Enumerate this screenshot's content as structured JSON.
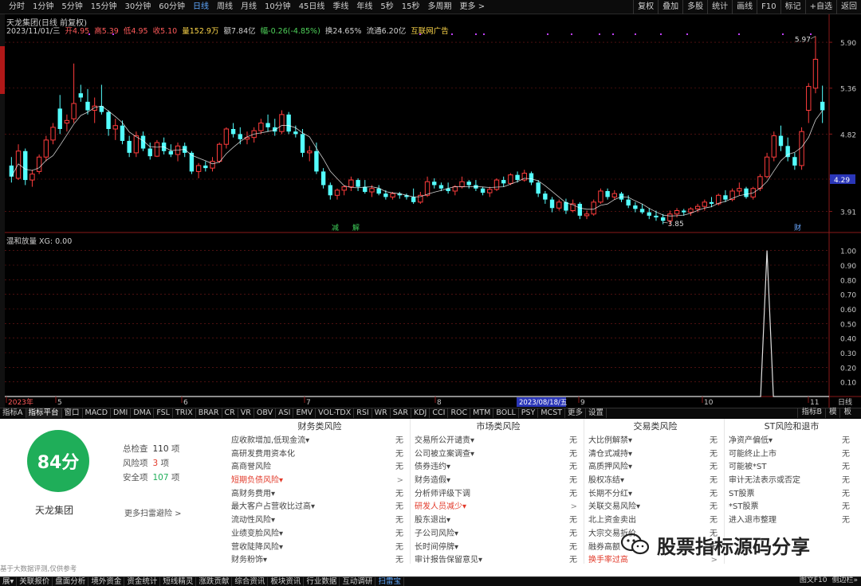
{
  "topbar": {
    "periods": [
      "分时",
      "1分钟",
      "5分钟",
      "15分钟",
      "30分钟",
      "60分钟",
      "日线",
      "周线",
      "月线",
      "10分钟",
      "45日线",
      "季线",
      "年线",
      "5秒",
      "15秒",
      "多周期",
      "更多 >"
    ],
    "active_period": "日线",
    "right_buttons": [
      "复权",
      "叠加",
      "多股",
      "统计",
      "画线",
      "F10",
      "标记",
      "+自选",
      "返回"
    ]
  },
  "info": {
    "title": "天龙集团(日线 前复权)",
    "date": "2023/11/01/三",
    "open": "开4.95",
    "high": "高5.39",
    "low": "低4.95",
    "close": "收5.10",
    "volume": "量152.9万",
    "amount": "额7.84亿",
    "change": "幅-0.26(-4.85%)",
    "turnover": "换24.65%",
    "float_cap": "流通6.20亿",
    "tag": "互联网广告"
  },
  "colors": {
    "up": "#ff3c3c",
    "down": "#54ffff",
    "ma": "#ffffff",
    "grid": "#7a1a1a",
    "axis_text": "#c8c8c8",
    "indicator_line": "#e0e0e0",
    "score_green": "#1fae59",
    "warn_red": "#e23a2a",
    "price_tag_bg": "#2a36b8"
  },
  "chart_data": {
    "type": "candlestick",
    "price_axis": [
      "5.90",
      "5.36",
      "4.82",
      "4.29",
      "3.91"
    ],
    "ylim": [
      3.7,
      6.06
    ],
    "current_price_label": "4.29",
    "high_label": "5.97",
    "low_label": "3.85",
    "x_labels": [
      "2023年",
      "5",
      "6",
      "7",
      "8",
      "9",
      "10",
      "11"
    ],
    "date_tag": "2023/08/18/五",
    "markers": [
      "减",
      "解",
      "财"
    ],
    "candles": [
      [
        4.45,
        4.55,
        4.25,
        4.32
      ],
      [
        4.3,
        4.7,
        4.28,
        4.62
      ],
      [
        4.62,
        4.65,
        4.22,
        4.28
      ],
      [
        4.28,
        4.4,
        4.2,
        4.35
      ],
      [
        4.38,
        4.58,
        4.35,
        4.55
      ],
      [
        4.55,
        4.8,
        4.5,
        4.75
      ],
      [
        4.75,
        4.95,
        4.7,
        4.9
      ],
      [
        5.12,
        5.28,
        4.82,
        4.88
      ],
      [
        4.95,
        5.05,
        4.85,
        4.98
      ],
      [
        5.0,
        5.65,
        4.95,
        5.18
      ],
      [
        5.3,
        5.4,
        5.2,
        5.25
      ],
      [
        5.2,
        5.35,
        5.05,
        5.1
      ],
      [
        5.1,
        5.25,
        4.95,
        5.15
      ],
      [
        5.15,
        5.4,
        5.05,
        5.08
      ],
      [
        5.08,
        5.1,
        4.8,
        4.88
      ],
      [
        4.88,
        5.0,
        4.75,
        4.92
      ],
      [
        4.92,
        4.98,
        4.7,
        4.74
      ],
      [
        4.74,
        4.8,
        4.55,
        4.6
      ],
      [
        4.6,
        4.85,
        4.55,
        4.8
      ],
      [
        4.8,
        4.85,
        4.62,
        4.65
      ],
      [
        4.65,
        4.72,
        4.52,
        4.56
      ],
      [
        4.56,
        4.75,
        4.55,
        4.72
      ],
      [
        4.72,
        4.78,
        4.58,
        4.62
      ],
      [
        4.62,
        4.7,
        4.55,
        4.58
      ],
      [
        4.58,
        4.72,
        4.5,
        4.68
      ],
      [
        4.68,
        4.72,
        4.55,
        4.6
      ],
      [
        4.6,
        4.62,
        4.35,
        4.38
      ],
      [
        4.38,
        4.48,
        4.3,
        4.45
      ],
      [
        4.45,
        4.5,
        4.38,
        4.42
      ],
      [
        4.42,
        4.55,
        4.38,
        4.5
      ],
      [
        4.5,
        4.72,
        4.48,
        4.7
      ],
      [
        4.7,
        4.9,
        4.65,
        4.88
      ],
      [
        4.88,
        4.95,
        4.78,
        4.82
      ],
      [
        4.82,
        4.9,
        4.7,
        4.76
      ],
      [
        4.76,
        4.85,
        4.7,
        4.78
      ],
      [
        4.78,
        4.9,
        4.72,
        4.86
      ],
      [
        4.86,
        5.0,
        4.82,
        4.95
      ],
      [
        4.95,
        5.05,
        4.85,
        4.9
      ],
      [
        4.9,
        5.0,
        4.8,
        4.85
      ],
      [
        4.85,
        5.1,
        4.82,
        5.05
      ],
      [
        5.05,
        5.08,
        4.82,
        4.85
      ],
      [
        4.85,
        4.92,
        4.78,
        4.82
      ],
      [
        4.82,
        4.88,
        4.55,
        4.6
      ],
      [
        4.6,
        4.68,
        4.5,
        4.62
      ],
      [
        4.62,
        4.72,
        4.35,
        4.38
      ],
      [
        4.38,
        4.42,
        4.18,
        4.22
      ],
      [
        4.22,
        4.25,
        4.05,
        4.1
      ],
      [
        4.1,
        4.18,
        4.05,
        4.16
      ],
      [
        4.16,
        4.22,
        4.1,
        4.2
      ],
      [
        4.2,
        4.32,
        4.15,
        4.28
      ],
      [
        4.28,
        4.3,
        4.15,
        4.2
      ],
      [
        4.2,
        4.28,
        4.12,
        4.14
      ],
      [
        4.14,
        4.22,
        4.08,
        4.18
      ],
      [
        4.18,
        4.22,
        4.1,
        4.12
      ],
      [
        4.12,
        4.16,
        4.05,
        4.08
      ],
      [
        4.08,
        4.14,
        4.05,
        4.12
      ],
      [
        4.12,
        4.14,
        4.06,
        4.1
      ],
      [
        4.1,
        4.12,
        4.05,
        4.08
      ],
      [
        4.08,
        4.18,
        4.0,
        4.02
      ],
      [
        4.02,
        4.14,
        4.0,
        4.1
      ],
      [
        4.1,
        4.32,
        4.08,
        4.26
      ],
      [
        4.26,
        4.3,
        4.18,
        4.22
      ],
      [
        4.22,
        4.25,
        4.15,
        4.18
      ],
      [
        4.18,
        4.25,
        4.12,
        4.15
      ],
      [
        4.15,
        4.22,
        4.1,
        4.2
      ],
      [
        4.2,
        4.32,
        4.18,
        4.26
      ],
      [
        4.26,
        4.28,
        4.18,
        4.22
      ],
      [
        4.22,
        4.28,
        4.15,
        4.18
      ],
      [
        4.18,
        4.2,
        4.1,
        4.13
      ],
      [
        4.13,
        4.2,
        4.08,
        4.17
      ],
      [
        4.17,
        4.3,
        4.15,
        4.28
      ],
      [
        4.28,
        4.32,
        4.2,
        4.24
      ],
      [
        4.24,
        4.36,
        4.22,
        4.34
      ],
      [
        4.34,
        4.38,
        4.25,
        4.28
      ],
      [
        4.28,
        4.4,
        4.26,
        4.36
      ],
      [
        4.36,
        4.38,
        4.22,
        4.25
      ],
      [
        4.25,
        4.28,
        4.08,
        4.12
      ],
      [
        4.12,
        4.15,
        4.0,
        4.05
      ],
      [
        4.05,
        4.08,
        3.9,
        3.95
      ],
      [
        3.95,
        4.05,
        3.92,
        4.02
      ],
      [
        4.02,
        4.06,
        3.88,
        3.92
      ],
      [
        3.92,
        4.05,
        3.9,
        4.0
      ],
      [
        4.0,
        4.02,
        3.82,
        3.86
      ],
      [
        3.86,
        3.92,
        3.82,
        3.88
      ],
      [
        3.88,
        4.05,
        3.86,
        4.02
      ],
      [
        4.02,
        4.18,
        4.0,
        4.15
      ],
      [
        4.15,
        4.18,
        4.05,
        4.08
      ],
      [
        4.08,
        4.16,
        4.05,
        4.12
      ],
      [
        4.12,
        4.14,
        4.02,
        4.05
      ],
      [
        4.05,
        4.1,
        3.95,
        3.98
      ],
      [
        3.98,
        4.02,
        3.9,
        3.94
      ],
      [
        3.94,
        4.0,
        3.88,
        3.9
      ],
      [
        3.9,
        3.95,
        3.82,
        3.86
      ],
      [
        3.86,
        3.92,
        3.8,
        3.84
      ],
      [
        3.84,
        3.88,
        3.76,
        3.8
      ],
      [
        3.8,
        3.92,
        3.75,
        3.88
      ],
      [
        3.88,
        3.95,
        3.84,
        3.92
      ],
      [
        3.92,
        3.94,
        3.86,
        3.9
      ],
      [
        3.9,
        3.96,
        3.86,
        3.94
      ],
      [
        3.94,
        4.0,
        3.9,
        3.97
      ],
      [
        3.97,
        4.05,
        3.92,
        4.02
      ],
      [
        4.02,
        4.08,
        3.96,
        4.0
      ],
      [
        4.0,
        4.12,
        3.98,
        4.1
      ],
      [
        4.1,
        4.16,
        4.02,
        4.05
      ],
      [
        4.05,
        4.18,
        4.03,
        4.15
      ],
      [
        4.15,
        4.25,
        4.1,
        4.18
      ],
      [
        4.18,
        4.2,
        4.06,
        4.08
      ],
      [
        4.08,
        4.2,
        4.05,
        4.18
      ],
      [
        4.18,
        4.35,
        4.15,
        4.32
      ],
      [
        4.32,
        4.6,
        4.3,
        4.55
      ],
      [
        4.55,
        4.85,
        4.5,
        4.8
      ],
      [
        4.8,
        4.92,
        4.62,
        4.68
      ],
      [
        4.68,
        4.78,
        4.5,
        4.55
      ],
      [
        4.55,
        4.6,
        4.4,
        4.45
      ],
      [
        4.45,
        4.9,
        4.4,
        4.85
      ],
      [
        5.1,
        5.42,
        4.95,
        5.38
      ],
      [
        5.36,
        5.97,
        5.3,
        5.7
      ],
      [
        5.2,
        5.39,
        4.95,
        5.1
      ]
    ],
    "indicator": {
      "title": "温和放量 XG: 0.00",
      "axis": [
        "1.00",
        "0.90",
        "0.80",
        "0.70",
        "0.60",
        "0.50",
        "0.40",
        "0.30",
        "0.20",
        "0.10"
      ],
      "ylim": [
        0,
        1.08
      ],
      "spike_index": 109,
      "spike_value": 1.0
    }
  },
  "indicator_tabs": [
    "指标A",
    "指标平台",
    "窗口",
    "MACD",
    "DMI",
    "DMA",
    "FSL",
    "TRIX",
    "BRAR",
    "CR",
    "VR",
    "OBV",
    "ASI",
    "EMV",
    "VOL-TDX",
    "RSI",
    "WR",
    "SAR",
    "KDJ",
    "CCI",
    "ROC",
    "MTM",
    "BOLL",
    "PSY",
    "MCST",
    "更多",
    "设置"
  ],
  "active_tab": "指标平台",
  "right_tabs": [
    "指标B",
    "模",
    "板"
  ],
  "panel": {
    "score": "84分",
    "company": "天龙集团",
    "stats": [
      {
        "label": "总检查",
        "value": "110",
        "unit": "项",
        "color": "#333333"
      },
      {
        "label": "风险项",
        "value": "3",
        "unit": "项",
        "color": "#e23a2a"
      },
      {
        "label": "安全项",
        "value": "107",
        "unit": "项",
        "color": "#1fae59"
      }
    ],
    "more_scan": "更多扫雷避险 >",
    "disclaimer": "基于大数据评测,仅供参考",
    "columns": [
      {
        "title": "财务类风险",
        "items": [
          {
            "label": "应收款增加,低现金流▾",
            "status": "无",
            "warn": false
          },
          {
            "label": "高研发费用资本化",
            "status": "无",
            "warn": false
          },
          {
            "label": "高商誉风险",
            "status": "无",
            "warn": false
          },
          {
            "label": "短期负债风险▾",
            "status": ">",
            "warn": true
          },
          {
            "label": "高财务费用▾",
            "status": "无",
            "warn": false
          },
          {
            "label": "最大客户占营收比过高▾",
            "status": "无",
            "warn": false
          },
          {
            "label": "流动性风险▾",
            "status": "无",
            "warn": false
          },
          {
            "label": "业绩变脸风险▾",
            "status": "无",
            "warn": false
          },
          {
            "label": "营收陡降风险▾",
            "status": "无",
            "warn": false
          },
          {
            "label": "财务粉饰▾",
            "status": "无",
            "warn": false
          }
        ]
      },
      {
        "title": "市场类风险",
        "items": [
          {
            "label": "交易所公开谴责▾",
            "status": "无",
            "warn": false
          },
          {
            "label": "公司被立案调查▾",
            "status": "无",
            "warn": false
          },
          {
            "label": "债券违约▾",
            "status": "无",
            "warn": false
          },
          {
            "label": "财务造假▾",
            "status": "无",
            "warn": false
          },
          {
            "label": "分析师评级下调",
            "status": "无",
            "warn": false
          },
          {
            "label": "研发人员减少▾",
            "status": ">",
            "warn": true
          },
          {
            "label": "股东退出▾",
            "status": "无",
            "warn": false
          },
          {
            "label": "子公司风险▾",
            "status": "无",
            "warn": false
          },
          {
            "label": "长时间停牌▾",
            "status": "无",
            "warn": false
          },
          {
            "label": "审计报告保留意见▾",
            "status": "无",
            "warn": false
          }
        ]
      },
      {
        "title": "交易类风险",
        "items": [
          {
            "label": "大比例解禁▾",
            "status": "无",
            "warn": false
          },
          {
            "label": "清仓式减持▾",
            "status": "无",
            "warn": false
          },
          {
            "label": "高质押风险▾",
            "status": "无",
            "warn": false
          },
          {
            "label": "股权冻结▾",
            "status": "无",
            "warn": false
          },
          {
            "label": "长期不分红▾",
            "status": "无",
            "warn": false
          },
          {
            "label": "关联交易风险▾",
            "status": "无",
            "warn": false
          },
          {
            "label": "北上资金卖出",
            "status": "无",
            "warn": false
          },
          {
            "label": "大宗交易折价",
            "status": "无",
            "warn": false
          },
          {
            "label": "融券高额",
            "status": "无",
            "warn": false
          },
          {
            "label": "换手率过高",
            "status": ">",
            "warn": true
          }
        ]
      },
      {
        "title": "ST风险和退市",
        "items": [
          {
            "label": "净资产偏低▾",
            "status": "无",
            "warn": false
          },
          {
            "label": "可能终止上市",
            "status": "无",
            "warn": false
          },
          {
            "label": "可能被*ST",
            "status": "无",
            "warn": false
          },
          {
            "label": "审计无法表示或否定",
            "status": "无",
            "warn": false
          },
          {
            "label": "ST股票",
            "status": "无",
            "warn": false
          },
          {
            "label": "*ST股票",
            "status": "无",
            "warn": false
          },
          {
            "label": "进入退市整理",
            "status": "无",
            "warn": false
          }
        ]
      }
    ]
  },
  "watermark": {
    "text": "股票指标源码分享",
    "icon": "wechat-icon"
  },
  "bottombar": {
    "tabs": [
      "展▾",
      "关联报价",
      "盘面分析",
      "境外资金",
      "资金统计",
      "短线精灵",
      "涨跌贡献",
      "综合资讯",
      "板块资讯",
      "行业数据",
      "互动调研",
      "扫雷宝"
    ],
    "active": "扫雷宝",
    "right": [
      "图文F10",
      "侧边栏»"
    ]
  }
}
